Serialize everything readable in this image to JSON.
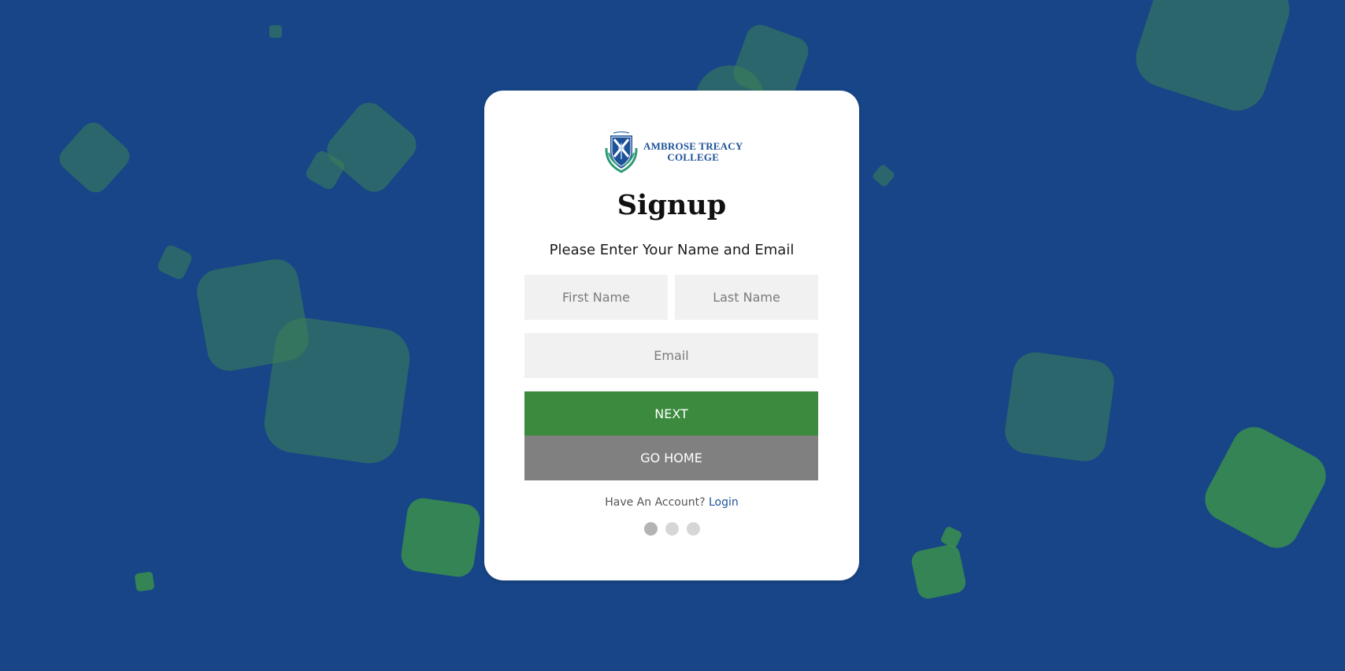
{
  "brand": {
    "logo_line1": "AMBROSE TREACY",
    "logo_line2": "COLLEGE",
    "primary_color": "#1d5199",
    "accent_color": "#3b8a3e",
    "background_color": "#174587"
  },
  "form": {
    "title": "Signup",
    "subtitle": "Please Enter Your Name and Email",
    "first_name_placeholder": "First Name",
    "first_name_value": "",
    "last_name_placeholder": "Last Name",
    "last_name_value": "",
    "email_placeholder": "Email",
    "email_value": ""
  },
  "actions": {
    "next_label": "NEXT",
    "go_home_label": "GO HOME"
  },
  "account": {
    "prompt": "Have An Account?",
    "login_label": "Login"
  },
  "stepper": {
    "steps": 3,
    "current_step": 1
  }
}
